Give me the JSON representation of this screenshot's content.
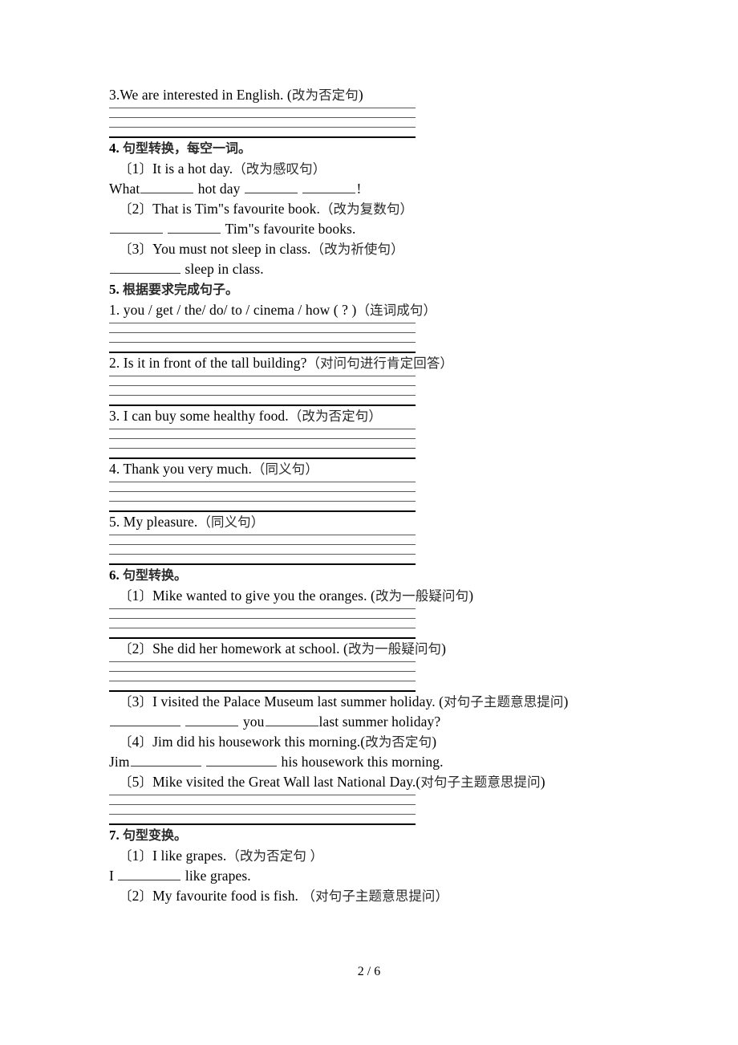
{
  "document": {
    "page_label": "2 / 6"
  },
  "blocks": [
    {
      "kind": "question",
      "name": "question-3-we-are-interested",
      "text": "3.We are interested in English. (改为否定句)"
    },
    {
      "kind": "rules",
      "name": "answer-lines-q3"
    },
    {
      "kind": "section",
      "name": "section-4-heading",
      "text": "4. 句型转换，每空一词。"
    },
    {
      "kind": "question",
      "indent": true,
      "name": "q4-item-1",
      "text": "〔1〕It is a hot day.（改为感叹句）"
    },
    {
      "kind": "fill",
      "name": "q4-item-1-answer",
      "parts": [
        "What",
        "BLANK_MD",
        " hot day ",
        "BLANK_MD",
        " ",
        "BLANK_MD",
        "!"
      ]
    },
    {
      "kind": "question",
      "indent": true,
      "name": "q4-item-2",
      "text": "〔2〕That is Tim\"s favourite book.（改为复数句）"
    },
    {
      "kind": "fill",
      "name": "q4-item-2-answer",
      "parts": [
        "BLANK_MD",
        " ",
        "BLANK_MD",
        " Tim\"s favourite books."
      ]
    },
    {
      "kind": "question",
      "indent": true,
      "name": "q4-item-3",
      "text": "〔3〕You must not sleep in class.（改为祈使句）"
    },
    {
      "kind": "fill",
      "name": "q4-item-3-answer",
      "parts": [
        "BLANK_XL",
        " sleep in class."
      ]
    },
    {
      "kind": "section",
      "name": "section-5-heading",
      "text": "5. 根据要求完成句子。"
    },
    {
      "kind": "question",
      "name": "q5-item-1",
      "text": "1. you / get / the/ do/ to / cinema / how ( ? )（连词成句）"
    },
    {
      "kind": "rules",
      "name": "answer-lines-q5-1"
    },
    {
      "kind": "question",
      "name": "q5-item-2",
      "text": "2. Is it in front of the tall building?（对问句进行肯定回答）"
    },
    {
      "kind": "rules",
      "name": "answer-lines-q5-2"
    },
    {
      "kind": "question",
      "name": "q5-item-3",
      "text": "3. I can buy some healthy food.（改为否定句）"
    },
    {
      "kind": "rules",
      "name": "answer-lines-q5-3"
    },
    {
      "kind": "question",
      "name": "q5-item-4",
      "text": "4. Thank you very much.（同义句）"
    },
    {
      "kind": "rules",
      "name": "answer-lines-q5-4"
    },
    {
      "kind": "question",
      "name": "q5-item-5",
      "text": "5. My pleasure.（同义句）"
    },
    {
      "kind": "rules",
      "name": "answer-lines-q5-5"
    },
    {
      "kind": "section",
      "name": "section-6-heading",
      "text": "6. 句型转换。"
    },
    {
      "kind": "question",
      "indent": true,
      "name": "q6-item-1",
      "text": "〔1〕Mike wanted to give you the oranges. (改为一般疑问句)"
    },
    {
      "kind": "rules",
      "name": "answer-lines-q6-1"
    },
    {
      "kind": "question",
      "indent": true,
      "name": "q6-item-2",
      "text": "〔2〕She did her homework at school. (改为一般疑问句)"
    },
    {
      "kind": "rules",
      "name": "answer-lines-q6-2"
    },
    {
      "kind": "question",
      "indent": true,
      "name": "q6-item-3",
      "text": "〔3〕I visited the Palace Museum last summer holiday. (对句子主题意思提问)"
    },
    {
      "kind": "fill",
      "name": "q6-item-3-answer",
      "parts": [
        "BLANK_XL",
        " ",
        "BLANK_MD",
        " you",
        "BLANK_MD",
        "last summer holiday?"
      ]
    },
    {
      "kind": "question",
      "indent": true,
      "name": "q6-item-4",
      "text": "〔4〕Jim did his housework this morning.(改为否定句)"
    },
    {
      "kind": "fill",
      "name": "q6-item-4-answer",
      "parts": [
        "Jim",
        "BLANK_XL",
        " ",
        "BLANK_XL",
        " his housework this morning."
      ]
    },
    {
      "kind": "question",
      "indent": true,
      "name": "q6-item-5",
      "text": "〔5〕Mike visited the Great Wall last National Day.(对句子主题意思提问)"
    },
    {
      "kind": "rules",
      "name": "answer-lines-q6-5"
    },
    {
      "kind": "section",
      "name": "section-7-heading",
      "text": "7. 句型变换。"
    },
    {
      "kind": "question",
      "indent": true,
      "name": "q7-item-1",
      "text": "〔1〕I like grapes.（改为否定句 ）"
    },
    {
      "kind": "fill",
      "name": "q7-item-1-answer",
      "parts": [
        "I ",
        "BLANK_LG",
        " like grapes."
      ]
    },
    {
      "kind": "question",
      "indent": true,
      "name": "q7-item-2",
      "text": "〔2〕My favourite food is fish. （对句子主题意思提问）"
    }
  ]
}
